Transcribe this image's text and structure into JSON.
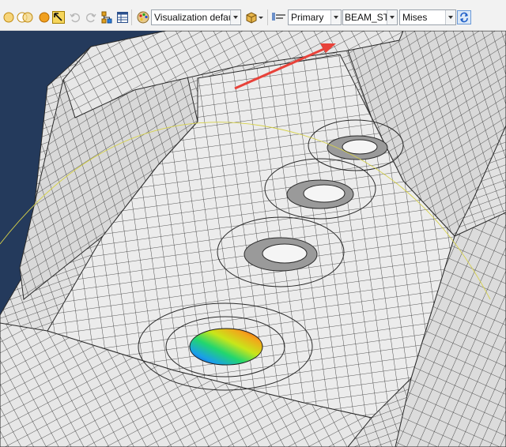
{
  "toolbar": {
    "visualization_combo": {
      "value": "Visualization defaults"
    },
    "variable_type_combo": {
      "value": "Primary"
    },
    "field_output_combo": {
      "value": "BEAM_STRES"
    },
    "invariant_combo": {
      "value": "Mises"
    },
    "icons": [
      "circle-select-icon",
      "union-circles-icon",
      "orange-ball-icon",
      "query-arrow-icon",
      "undo-icon",
      "redo-icon",
      "assembly-tree-icon",
      "table-icon",
      "color-palette-icon",
      "cube-render-icon",
      "legend-icon",
      "sync-icon"
    ]
  },
  "viewport": {
    "background_color": "#243a5c",
    "mesh_color": "#e7e7e7",
    "edge_color": "#2a2a2a",
    "annotation_arrow_color": "#e8423a",
    "contour_colors": [
      "#1a2ad6",
      "#1aa0e8",
      "#22d66e",
      "#c8e61a",
      "#f2a61a",
      "#e8281a"
    ]
  }
}
